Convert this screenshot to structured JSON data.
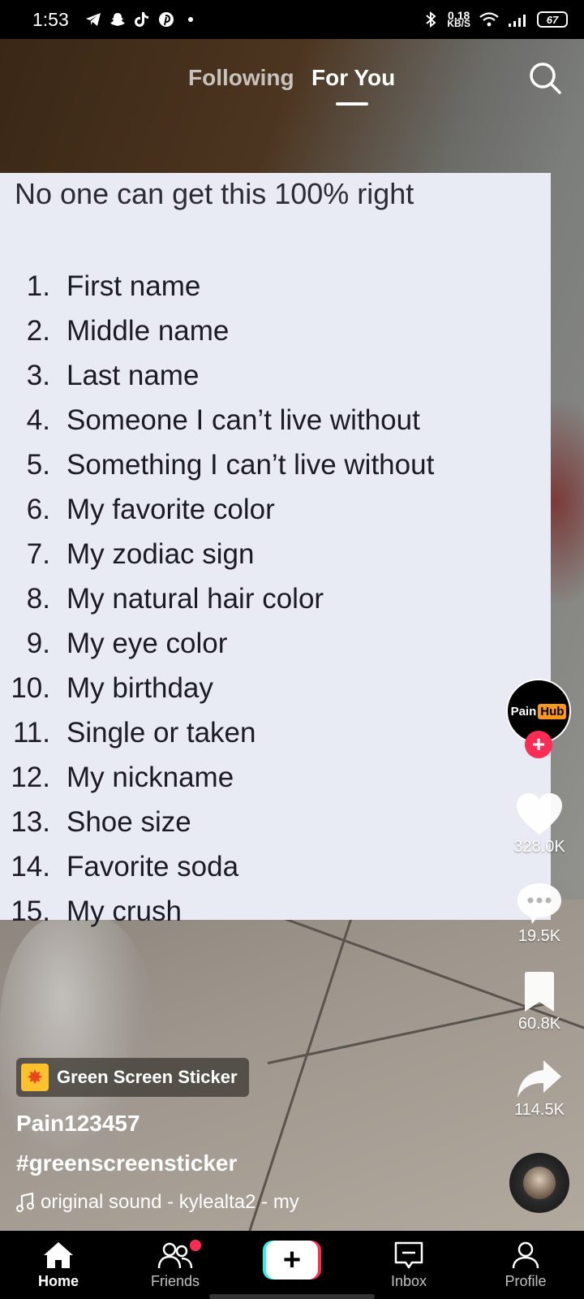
{
  "status_bar": {
    "time": "1:53",
    "app_icons": [
      "telegram-icon",
      "snapchat-icon",
      "tiktok-icon",
      "pinterest-icon",
      "dot-icon"
    ],
    "net_speed_value": "0.18",
    "net_speed_unit": "KB/S",
    "battery": "67"
  },
  "top_nav": {
    "following": "Following",
    "for_you": "For You",
    "active_tab": "For You"
  },
  "sticker": {
    "title": "No one can get this 100% right",
    "items": [
      {
        "num": "1.",
        "text": "First name"
      },
      {
        "num": "2.",
        "text": "Middle name"
      },
      {
        "num": "3.",
        "text": "Last name"
      },
      {
        "num": "4.",
        "text": "Someone I can’t live without"
      },
      {
        "num": "5.",
        "text": "Something I can’t live without"
      },
      {
        "num": "6.",
        "text": "My favorite color"
      },
      {
        "num": "7.",
        "text": "My zodiac sign"
      },
      {
        "num": "8.",
        "text": "My natural hair color"
      },
      {
        "num": "9.",
        "text": "My eye color"
      },
      {
        "num": "10.",
        "text": "My birthday"
      },
      {
        "num": "11.",
        "text": "Single or taken"
      },
      {
        "num": "12.",
        "text": "My nickname"
      },
      {
        "num": "13.",
        "text": "Shoe size"
      },
      {
        "num": "14.",
        "text": "Favorite soda"
      },
      {
        "num": "15.",
        "text": "My crush"
      }
    ]
  },
  "creator": {
    "avatar_text_1": "Pain",
    "avatar_text_2": "Hub",
    "follow_symbol": "+"
  },
  "actions": {
    "likes": "328.0K",
    "comments": "19.5K",
    "bookmarks": "60.8K",
    "shares": "114.5K"
  },
  "post": {
    "effect_label": "Green Screen Sticker",
    "username": "Pain123457",
    "caption": "#greenscreensticker",
    "sound": "original sound - kylealta2 - my"
  },
  "bottom_nav": {
    "home": "Home",
    "friends": "Friends",
    "create_symbol": "+",
    "inbox": "Inbox",
    "profile": "Profile"
  },
  "colors": {
    "accent_pink": "#fe2c55",
    "accent_cyan": "#25f4ee",
    "sticker_bg": "#e8ebf4",
    "brand_orange": "#f7971d"
  }
}
